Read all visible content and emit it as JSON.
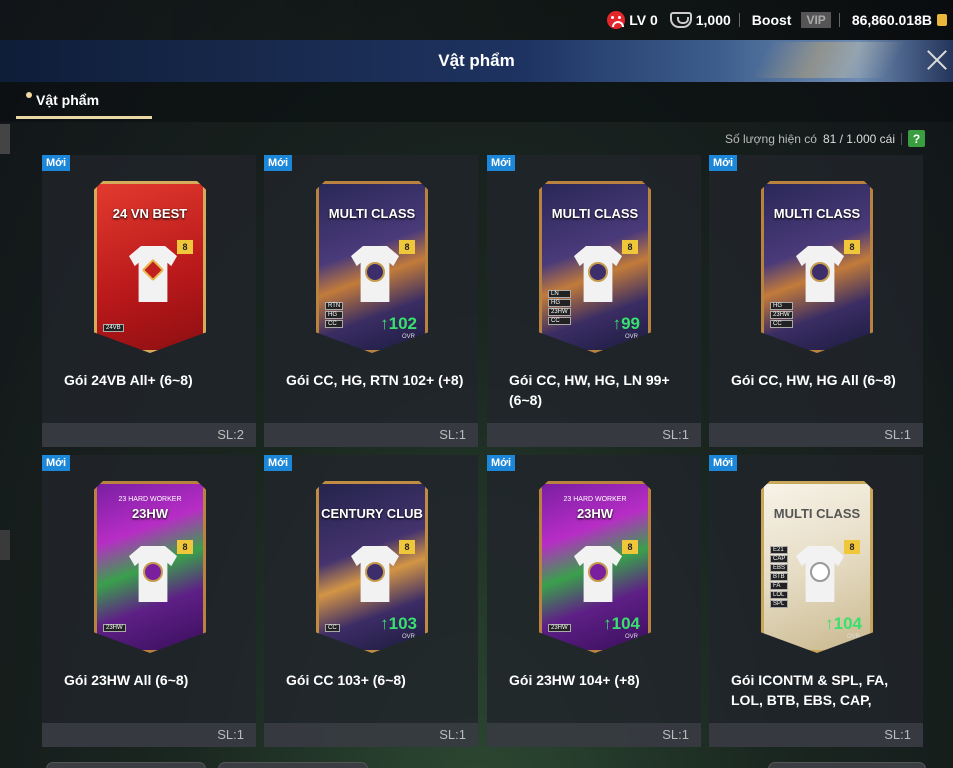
{
  "topbar": {
    "level": "LV 0",
    "points": "1,000",
    "boost": "Boost",
    "vip": "VIP",
    "coins": "86,860.018B"
  },
  "header": {
    "title": "Vật phẩm"
  },
  "tabs": [
    {
      "label": "Vật phẩm"
    }
  ],
  "quantity": {
    "label": "Số lượng hiện có",
    "value": "81 / 1.000 cái",
    "help": "?"
  },
  "items": [
    {
      "badge": "Mới",
      "pack_title": "24 VN BEST",
      "pack_sub": "",
      "grade": "8",
      "ovr": "",
      "chips": [
        "24VB"
      ],
      "name": "Gói 24VB All+ (6~8)",
      "sl": "SL:2"
    },
    {
      "badge": "Mới",
      "pack_title": "MULTI CLASS",
      "pack_sub": "",
      "grade": "8",
      "ovr": "102",
      "chips": [
        "RTN",
        "HG",
        "CC"
      ],
      "name": "Gói CC, HG, RTN 102+ (+8)",
      "sl": "SL:1"
    },
    {
      "badge": "Mới",
      "pack_title": "MULTI CLASS",
      "pack_sub": "",
      "grade": "8",
      "ovr": "99",
      "chips": [
        "LN",
        "HG",
        "23HW",
        "CC"
      ],
      "name": "Gói CC, HW, HG, LN 99+ (6~8)",
      "sl": "SL:1"
    },
    {
      "badge": "Mới",
      "pack_title": "MULTI CLASS",
      "pack_sub": "",
      "grade": "8",
      "ovr": "",
      "chips": [
        "HG",
        "23HW",
        "CC"
      ],
      "name": "Gói CC, HW, HG All (6~8)",
      "sl": "SL:1"
    },
    {
      "badge": "Mới",
      "pack_title": "23HW",
      "pack_sub": "23 HARD WORKER",
      "grade": "8",
      "ovr": "",
      "chips": [
        "23HW"
      ],
      "name": "Gói 23HW All (6~8)",
      "sl": "SL:1"
    },
    {
      "badge": "Mới",
      "pack_title": "CENTURY CLUB",
      "pack_sub": "",
      "grade": "8",
      "ovr": "103",
      "chips": [
        "CC"
      ],
      "name": "Gói CC 103+ (6~8)",
      "sl": "SL:1"
    },
    {
      "badge": "Mới",
      "pack_title": "23HW",
      "pack_sub": "23 HARD WORKER",
      "grade": "8",
      "ovr": "104",
      "chips": [
        "23HW"
      ],
      "name": "Gói 23HW 104+ (+8)",
      "sl": "SL:1"
    },
    {
      "badge": "Mới",
      "pack_title": "MULTI CLASS",
      "pack_sub": "",
      "grade": "8",
      "ovr": "104",
      "chips": [
        "E21",
        "CAP",
        "EBS",
        "BTB",
        "FA",
        "LOL",
        "SPL"
      ],
      "name": "Gói ICONTM & SPL, FA, LOL, BTB, EBS, CAP,",
      "sl": "SL:1"
    }
  ],
  "ovr_label": "OVR"
}
